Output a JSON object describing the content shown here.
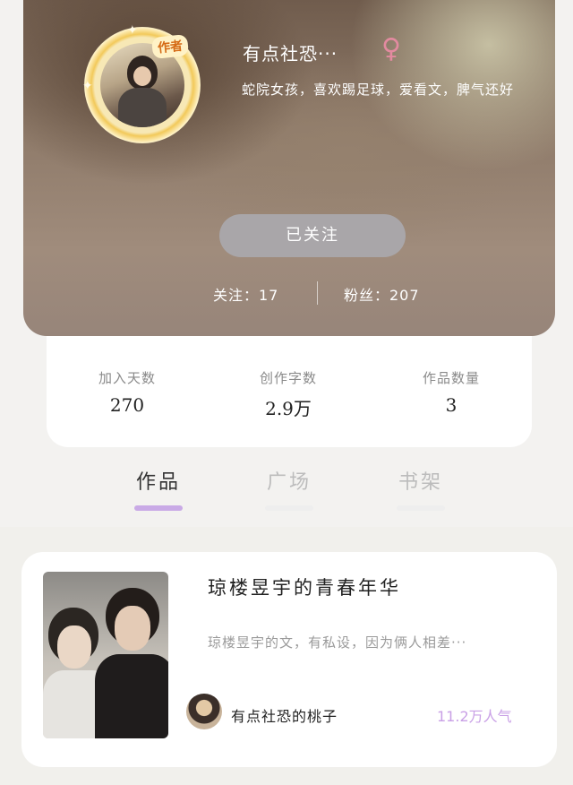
{
  "profile": {
    "badge": "作者",
    "name": "有点社恐···",
    "gender_symbol": "♀",
    "bio": "蛇院女孩，喜欢踢足球，爱看文，脾气还好",
    "follow_button": "已关注",
    "following": "关注：17",
    "fans": "粉丝：207"
  },
  "stats": [
    {
      "label": "加入天数",
      "value": "270"
    },
    {
      "label": "创作字数",
      "value": "2.9万"
    },
    {
      "label": "作品数量",
      "value": "3"
    }
  ],
  "tabs": [
    {
      "label": "作品",
      "active": true
    },
    {
      "label": "广场",
      "active": false
    },
    {
      "label": "书架",
      "active": false
    }
  ],
  "book": {
    "title": "琼楼昱宇的青春年华",
    "description": "琼楼昱宇的文，有私设，因为俩人相差···",
    "author": "有点社恐的桃子",
    "popularity": "11.2万人气"
  },
  "colors": {
    "accent": "#c9aae6",
    "gender": "#e38aa0"
  }
}
